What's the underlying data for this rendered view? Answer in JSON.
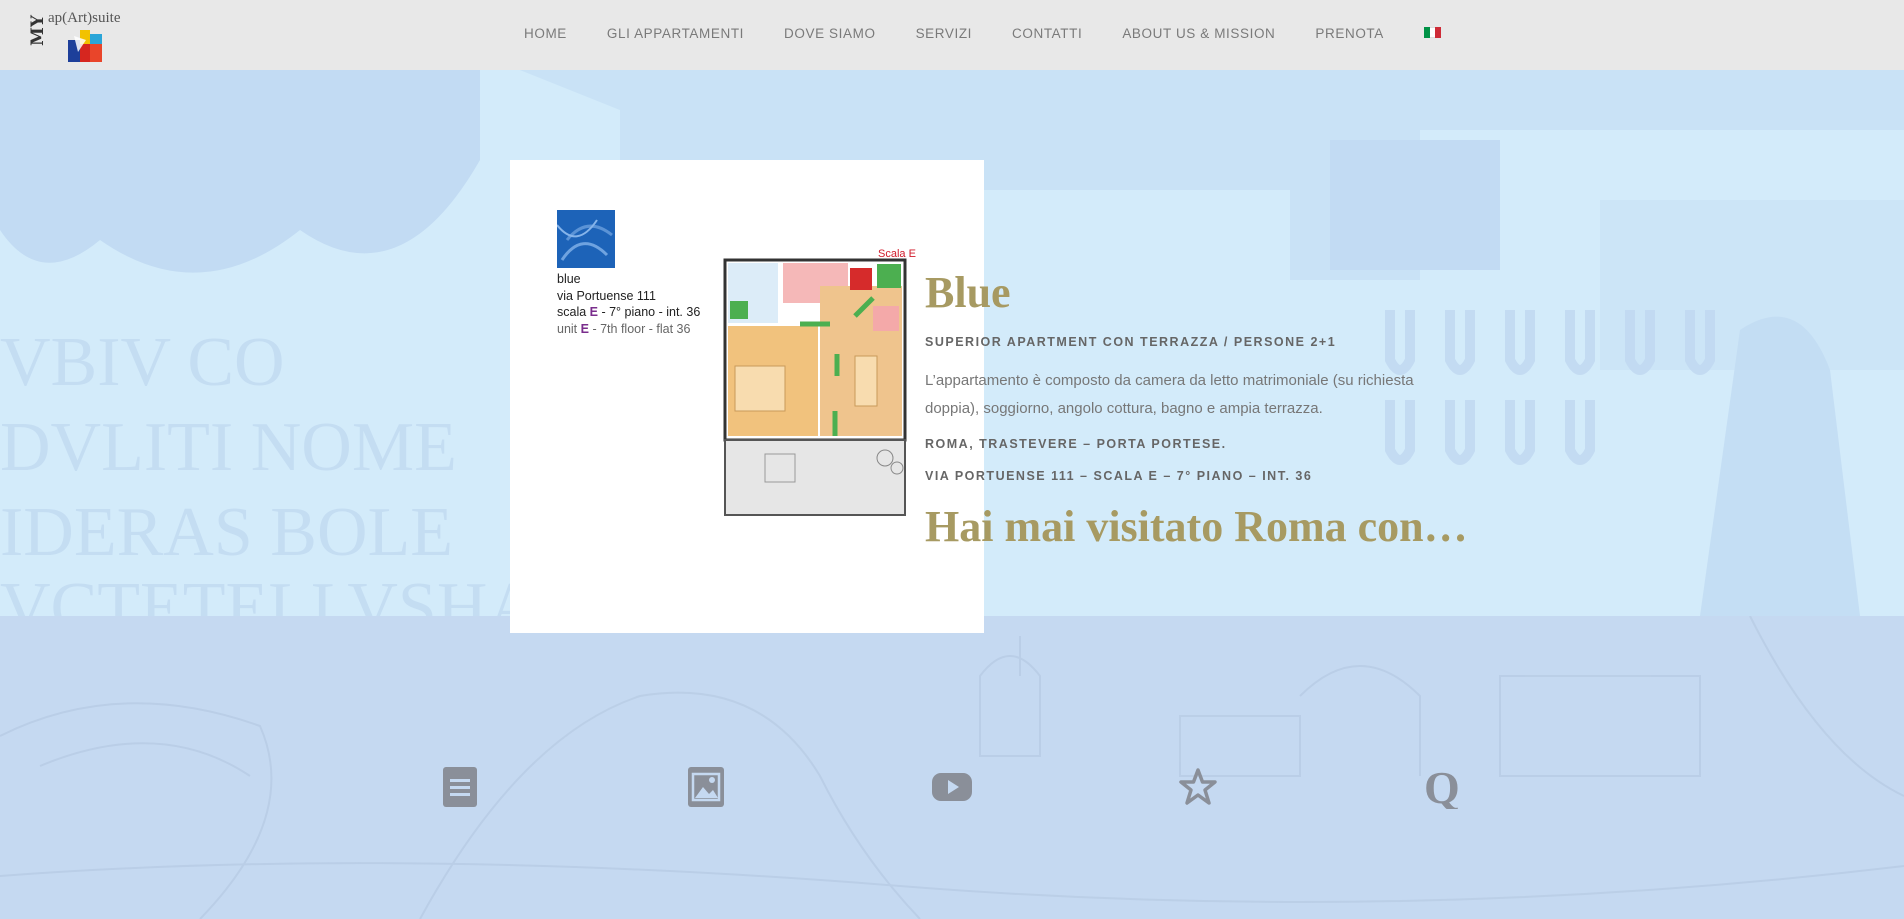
{
  "header": {
    "logo_text": "ap(Art)suite",
    "logo_mark": "MY",
    "nav": [
      {
        "label": "HOME"
      },
      {
        "label": "GLI APPARTAMENTI"
      },
      {
        "label": "DOVE SIAMO"
      },
      {
        "label": "SERVIZI"
      },
      {
        "label": "CONTATTI"
      },
      {
        "label": "ABOUT US & MISSION"
      },
      {
        "label": "PRENOTA"
      }
    ],
    "flag_colors": [
      "#009246",
      "#ffffff",
      "#ce2b37"
    ]
  },
  "plan": {
    "name": "blue",
    "street": "via Portuense 111",
    "scala_prefix": "scala ",
    "scala_letter": "E",
    "scala_suffix": " - 7° piano - int. 36",
    "unit_prefix": "unit ",
    "unit_letter": "E",
    "unit_suffix": " - 7th floor - flat 36",
    "scala_tag": "Scala E",
    "swatch_color": "#1d63b8"
  },
  "apartment": {
    "title": "Blue",
    "subtitle": "SUPERIOR APARTMENT CON TERRAZZA / PERSONE 2+1",
    "description": "L’appartamento è composto da camera da letto matrimoniale (su richiesta doppia), soggiorno, angolo cottura, bagno e ampia terrazza.",
    "location": "ROMA, TRASTEVERE – PORTA PORTESE.",
    "address": "VIA PORTUENSE 111 – SCALA E – 7° PIANO – INT. 36",
    "headline": "Hai mai visitato Roma con…"
  },
  "icon_row": [
    {
      "icon": "document-icon"
    },
    {
      "icon": "image-icon"
    },
    {
      "icon": "video-icon"
    },
    {
      "icon": "star-icon"
    },
    {
      "icon": "quote-icon"
    }
  ],
  "colors": {
    "accent_gold": "#a79a62",
    "header_bg": "#e8e8e8",
    "hero_bg": "#d3ebfa",
    "lower_bg": "#c5d9f1",
    "icon_grey": "#8a8f99"
  }
}
